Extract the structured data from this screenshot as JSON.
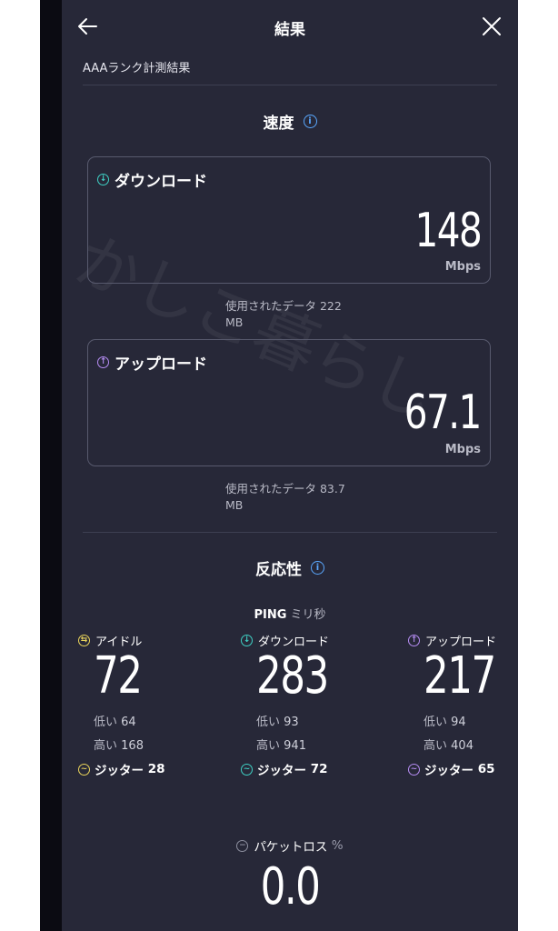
{
  "header": {
    "title": "結果"
  },
  "subtitle": "AAAランク計測結果",
  "speed": {
    "title": "速度",
    "download": {
      "label": "ダウンロード",
      "value": "148",
      "unit": "Mbps",
      "used_line1": "使用されたデータ 222",
      "used_line2": "MB"
    },
    "upload": {
      "label": "アップロード",
      "value": "67.1",
      "unit": "Mbps",
      "used_line1": "使用されたデータ 83.7",
      "used_line2": "MB"
    }
  },
  "responsiveness": {
    "title": "反応性",
    "ping_label": "PING",
    "ping_unit": "ミリ秒",
    "columns": [
      {
        "label": "アイドル",
        "value": "72",
        "low_label": "低い",
        "low": "64",
        "high_label": "高い",
        "high": "168",
        "jitter_label": "ジッター",
        "jitter": "28"
      },
      {
        "label": "ダウンロード",
        "value": "283",
        "low_label": "低い",
        "low": "93",
        "high_label": "高い",
        "high": "941",
        "jitter_label": "ジッター",
        "jitter": "72"
      },
      {
        "label": "アップロード",
        "value": "217",
        "low_label": "低い",
        "low": "94",
        "high_label": "高い",
        "high": "404",
        "jitter_label": "ジッター",
        "jitter": "65"
      }
    ],
    "packet_loss": {
      "label": "パケットロス",
      "unit": "%",
      "value": "0.0"
    }
  },
  "watermark": "かしこ暮らし",
  "colors": {
    "background": "#272838",
    "download": "#3fd0c4",
    "upload": "#b58cf2",
    "idle": "#e9d35b",
    "info": "#5aa8ff"
  },
  "icons": [
    "back-arrow-icon",
    "close-icon",
    "info-icon",
    "download-icon",
    "upload-icon",
    "idle-icon",
    "jitter-icon",
    "packet-loss-icon"
  ]
}
